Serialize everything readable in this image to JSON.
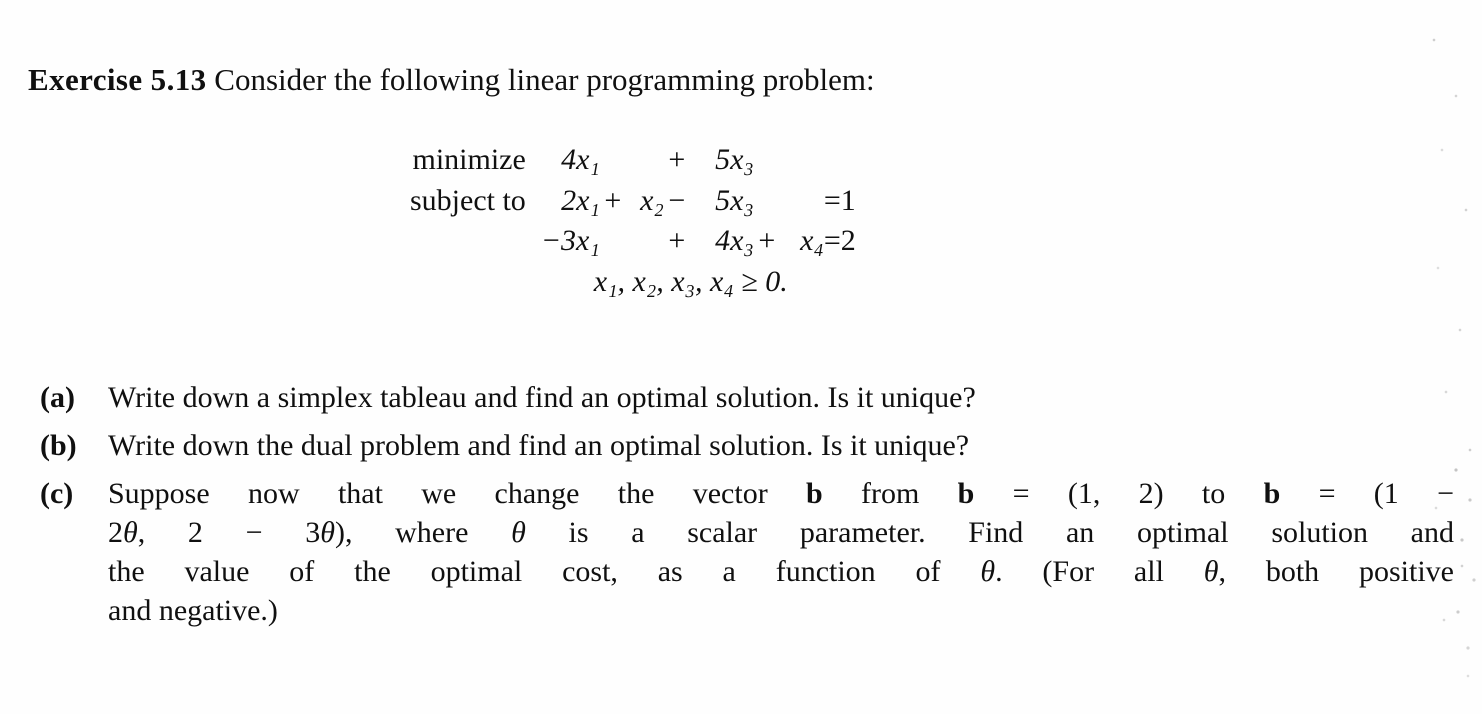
{
  "heading": {
    "label": "Exercise 5.13",
    "text": "Consider the following linear programming problem:"
  },
  "problem": {
    "objective": {
      "keyword": "minimize",
      "term1": "4x₁",
      "op1": "",
      "term2": "",
      "op2": "+",
      "term3": "5x₃",
      "op3": "",
      "term4": "",
      "relation": "",
      "rhs": ""
    },
    "constraint1": {
      "keyword": "subject to",
      "term1": "2x₁",
      "op1": "+",
      "term2": "x₂",
      "op2": "−",
      "term3": "5x₃",
      "op3": "",
      "term4": "",
      "relation": "=",
      "rhs": "1"
    },
    "constraint2": {
      "keyword": "",
      "term1": "−3x₁",
      "op1": "",
      "term2": "",
      "op2": "+",
      "term3": "4x₃",
      "op3": "+",
      "term4": "x₄",
      "relation": "=",
      "rhs": "2"
    },
    "nonnegativity": "x₁, x₂, x₃, x₄ ≥ 0."
  },
  "items": [
    {
      "label": "(a)",
      "text": "Write down a simplex tableau and find an optimal solution. Is it unique?"
    },
    {
      "label": "(b)",
      "text": "Write down the dual problem and find an optimal solution. Is it unique?"
    },
    {
      "label": "(c)",
      "text": "Suppose now that we change the vector b from b = (1, 2) to b = (1 − 2θ, 2 − 3θ), where θ is a scalar parameter. Find an optimal solution and the value of the optimal cost, as a function of θ. (For all θ, both positive and negative.)"
    }
  ],
  "item_c_lines": {
    "line1": "Suppose now that we change the vector b from b = (1, 2) to b = (1 −",
    "line2": "2θ, 2 − 3θ), where θ is a scalar parameter. Find an optimal solution and",
    "line3": "the value of the optimal cost, as a function of θ. (For all θ, both positive",
    "line4": "and negative.)"
  },
  "colors": {
    "page_background": "#fefefe",
    "ink": "#101010"
  }
}
